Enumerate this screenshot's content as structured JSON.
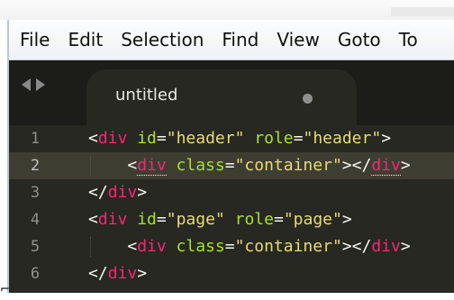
{
  "menubar": {
    "items": [
      "File",
      "Edit",
      "Selection",
      "Find",
      "View",
      "Goto",
      "To"
    ]
  },
  "tabs": [
    {
      "title": "untitled",
      "modified": true
    }
  ],
  "editor": {
    "active_line": 2,
    "lines": [
      {
        "number": "1",
        "tokens": [
          {
            "type": "punct",
            "text": "<"
          },
          {
            "type": "tag",
            "text": "div"
          },
          {
            "type": "punct",
            "text": " "
          },
          {
            "type": "attr",
            "text": "id"
          },
          {
            "type": "punct",
            "text": "="
          },
          {
            "type": "str",
            "text": "\"header\""
          },
          {
            "type": "punct",
            "text": " "
          },
          {
            "type": "attr",
            "text": "role"
          },
          {
            "type": "punct",
            "text": "="
          },
          {
            "type": "str",
            "text": "\"header\""
          },
          {
            "type": "punct",
            "text": ">"
          }
        ]
      },
      {
        "number": "2",
        "tokens": [
          {
            "type": "punct",
            "text": "    <"
          },
          {
            "type": "tag",
            "text": "div"
          },
          {
            "type": "punct",
            "text": " "
          },
          {
            "type": "attr",
            "text": "class"
          },
          {
            "type": "punct",
            "text": "="
          },
          {
            "type": "str",
            "text": "\"container\""
          },
          {
            "type": "punct",
            "text": "></"
          },
          {
            "type": "tag",
            "text": "div"
          },
          {
            "type": "punct",
            "text": ">"
          }
        ]
      },
      {
        "number": "3",
        "tokens": [
          {
            "type": "punct",
            "text": "</"
          },
          {
            "type": "tag",
            "text": "div"
          },
          {
            "type": "punct",
            "text": ">"
          }
        ]
      },
      {
        "number": "4",
        "tokens": [
          {
            "type": "punct",
            "text": "<"
          },
          {
            "type": "tag",
            "text": "div"
          },
          {
            "type": "punct",
            "text": " "
          },
          {
            "type": "attr",
            "text": "id"
          },
          {
            "type": "punct",
            "text": "="
          },
          {
            "type": "str",
            "text": "\"page\""
          },
          {
            "type": "punct",
            "text": " "
          },
          {
            "type": "attr",
            "text": "role"
          },
          {
            "type": "punct",
            "text": "="
          },
          {
            "type": "str",
            "text": "\"page\""
          },
          {
            "type": "punct",
            "text": ">"
          }
        ]
      },
      {
        "number": "5",
        "tokens": [
          {
            "type": "punct",
            "text": "    <"
          },
          {
            "type": "tag",
            "text": "div"
          },
          {
            "type": "punct",
            "text": " "
          },
          {
            "type": "attr",
            "text": "class"
          },
          {
            "type": "punct",
            "text": "="
          },
          {
            "type": "str",
            "text": "\"container\""
          },
          {
            "type": "punct",
            "text": "></"
          },
          {
            "type": "tag",
            "text": "div"
          },
          {
            "type": "punct",
            "text": ">"
          }
        ]
      },
      {
        "number": "6",
        "tokens": [
          {
            "type": "punct",
            "text": "</"
          },
          {
            "type": "tag",
            "text": "div"
          },
          {
            "type": "punct",
            "text": ">"
          }
        ]
      }
    ]
  },
  "colors": {
    "background": "#272822",
    "tag": "#f92672",
    "attribute": "#a6e22e",
    "string": "#e6db74",
    "punctuation": "#f8f8f2",
    "line_number": "#8f908a",
    "active_line": "#3e3d32"
  },
  "icons": {
    "nav_left": "triangle-left-icon",
    "nav_right": "triangle-right-icon",
    "modified_dot": "dot-icon"
  }
}
